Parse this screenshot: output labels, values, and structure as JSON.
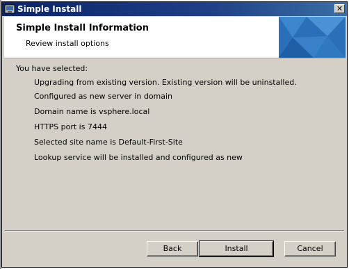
{
  "window": {
    "title": "Simple Install",
    "close_glyph": "✕",
    "icon": "installer-icon"
  },
  "header": {
    "title": "Simple Install Information",
    "subtitle": "Review install options"
  },
  "content": {
    "selected_label": "You have selected:",
    "options": [
      "Upgrading from existing version. Existing version will be uninstalled.",
      "Configured as new server in domain",
      "Domain name is vsphere.local",
      "HTTPS port is 7444",
      "Selected site name is Default-First-Site",
      "Lookup service will be installed and configured as new"
    ]
  },
  "buttons": {
    "back": "Back",
    "install": "Install",
    "cancel": "Cancel"
  },
  "colors": {
    "titlebar": "#0a246a",
    "dialog_bg": "#d4d0c8",
    "header_art": "#2a7fc4"
  }
}
